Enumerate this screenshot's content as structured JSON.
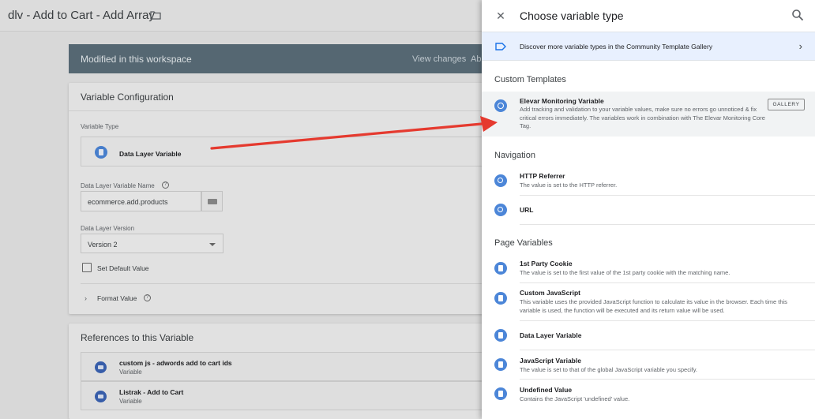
{
  "workspace": {
    "tag_title": "dlv - Add to Cart - Add Array",
    "modified_banner": "Modified in this workspace",
    "view_changes": "View changes",
    "ab_truncated": "Ab"
  },
  "config": {
    "card_title": "Variable Configuration",
    "variable_type_label": "Variable Type",
    "variable_type_value": "Data Layer Variable",
    "dlv_name_label": "Data Layer Variable Name",
    "dlv_name_value": "ecommerce.add.products",
    "dlv_version_label": "Data Layer Version",
    "dlv_version_value": "Version 2",
    "set_default_label": "Set Default Value",
    "format_value_label": "Format Value",
    "help_glyph": "?"
  },
  "references": {
    "card_title": "References to this Variable",
    "rows": [
      {
        "name": "custom js - adwords add to cart ids",
        "type": "Variable"
      },
      {
        "name": "Listrak - Add to Cart",
        "type": "Variable"
      }
    ]
  },
  "drawer": {
    "title": "Choose variable type",
    "close_glyph": "✕",
    "gallery_banner": "Discover more variable types in the Community Template Gallery",
    "gallery_chevron": "›",
    "sections": {
      "custom_templates": "Custom Templates",
      "navigation": "Navigation",
      "page_variables": "Page Variables"
    },
    "elevar": {
      "name": "Elevar Monitoring Variable",
      "description": "Add tracking and validation to your variable values, make sure no errors go unnoticed & fix critical errors immediately. The variables work in combination with The Elevar Monitoring Core Tag.",
      "badge": "GALLERY"
    },
    "navigation_items": [
      {
        "name": "HTTP Referrer",
        "description": "The value is set to the HTTP referrer."
      },
      {
        "name": "URL",
        "description": ""
      }
    ],
    "page_items": [
      {
        "name": "1st Party Cookie",
        "description": "The value is set to the first value of the 1st party cookie with the matching name."
      },
      {
        "name": "Custom JavaScript",
        "description": "This variable uses the provided JavaScript function to calculate its value in the browser. Each time this variable is used, the function will be executed and its return value will be used."
      },
      {
        "name": "Data Layer Variable",
        "description": ""
      },
      {
        "name": "JavaScript Variable",
        "description": "The value is set to that of the global JavaScript variable you specify."
      },
      {
        "name": "Undefined Value",
        "description": "Contains the JavaScript 'undefined' value."
      }
    ]
  },
  "icons": {
    "folder": "folder-icon",
    "close": "close-icon",
    "search": "search-icon",
    "tag": "tag-icon",
    "gear": "gear-icon",
    "globe": "globe-icon",
    "document": "document-icon"
  },
  "colors": {
    "accent": "#4c86d8",
    "banner": "#5b6e7a",
    "annotation_arrow": "#e53a2f",
    "gallery_banner": "#e8f0fe"
  }
}
